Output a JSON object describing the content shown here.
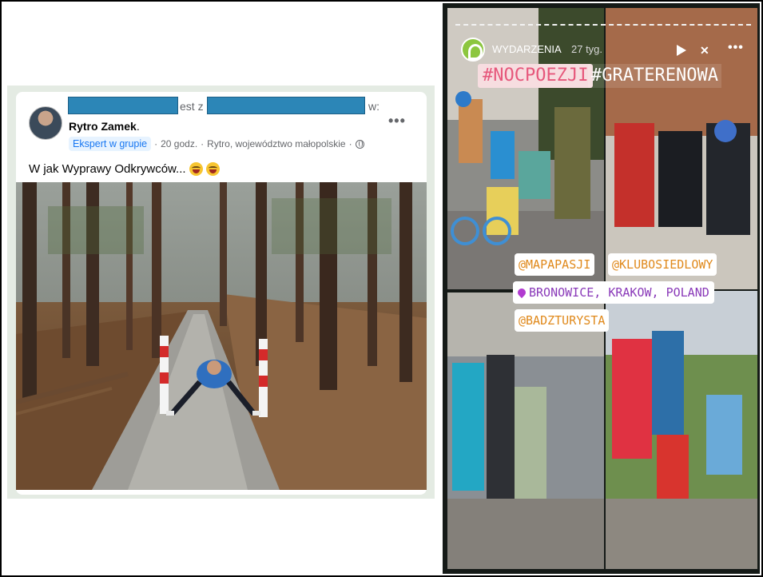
{
  "facebook_post": {
    "header_partial_1": "est z",
    "header_partial_2": "w:",
    "author": "Rytro Zamek",
    "author_suffix": ".",
    "badge": "Ekspert w grupie",
    "meta_separator": "·",
    "time": "20 godz.",
    "location": "Rytro, województwo małopolskie",
    "more_icon": "more-horizontal-icon",
    "privacy_icon": "globe-icon",
    "text": "W jak Wyprawy Odkrywców...",
    "emojis": [
      "laughing-emoji",
      "laughing-emoji"
    ]
  },
  "story": {
    "account": "WYDARZENIA",
    "time": "27 tyg.",
    "hashtags": [
      "#NOCPOEZJI",
      "#GRATERENOWA"
    ],
    "mentions": [
      "@MAPAPASJI",
      "@KLUBOSIEDLOWY",
      "@BADZTURYSTA"
    ],
    "location": "BRONOWICE, KRAKOW, POLAND",
    "colors": {
      "hashtag_pink": "#e6577b",
      "mention_orange": "#e08a1d",
      "location_purple": "#8a3ab9",
      "logo_green": "#8cc63f"
    }
  }
}
